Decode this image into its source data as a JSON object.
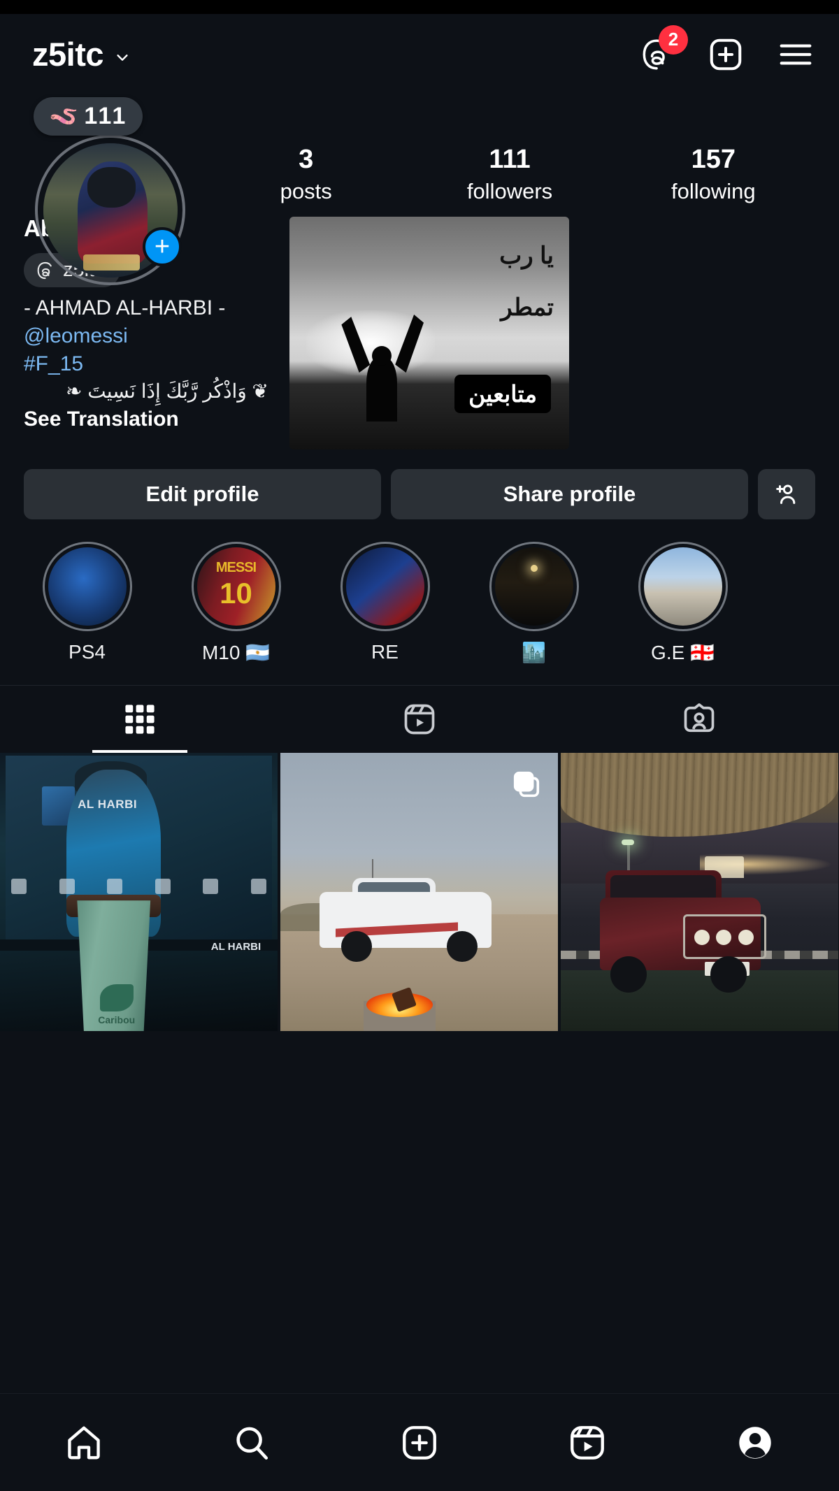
{
  "header": {
    "username": "z5itc",
    "chevron_icon": "chevron-down-icon",
    "threads_icon": "threads-icon",
    "threads_badge": "2",
    "create_icon": "plus-box-icon",
    "menu_icon": "hamburger-menu-icon"
  },
  "profile": {
    "note": {
      "emoji": "🪱",
      "text": "111"
    },
    "avatar_alt": "profile-picture",
    "add_story_label": "+",
    "stats": [
      {
        "num": "3",
        "label": "posts"
      },
      {
        "num": "111",
        "label": "followers"
      },
      {
        "num": "157",
        "label": "following"
      }
    ],
    "display_name": "Abu 7rb",
    "pronouns": "he",
    "threads_chip": {
      "icon": "threads-icon",
      "label": "z5itc"
    },
    "bio_lines": [
      {
        "text": "- AHMAD AL-HARBI -",
        "style": "plain"
      },
      {
        "text": "@leomessi",
        "style": "link"
      },
      {
        "text": "#F_15",
        "style": "link"
      }
    ],
    "bio_arabic": "❦ وَاذْكُر رَّبَّكَ إِذَا نَسِيتَ ❧",
    "see_translation": "See Translation",
    "card": {
      "line1": "يا رب",
      "line2": "تمطر",
      "badge": "متابعين"
    }
  },
  "actions": {
    "edit_profile": "Edit profile",
    "share_profile": "Share profile",
    "add_person_icon": "add-person-icon"
  },
  "highlights": [
    {
      "label": "PS4",
      "cover": "ps4-cover"
    },
    {
      "label": "M10 🇦🇷",
      "cover": "messi-cover",
      "cover_text": "MESSI",
      "cover_num": "10"
    },
    {
      "label": "RE",
      "cover": "resident-evil-cover"
    },
    {
      "label": "🏙️",
      "cover": "city-night-cover"
    },
    {
      "label": "G.E 🇬🇪",
      "cover": "georgia-cover"
    }
  ],
  "tabs": [
    {
      "name": "grid-tab",
      "icon": "grid-icon",
      "active": true
    },
    {
      "name": "reels-tab",
      "icon": "reels-icon",
      "active": false
    },
    {
      "name": "tagged-tab",
      "icon": "tagged-icon",
      "active": false
    }
  ],
  "posts": [
    {
      "name": "post-ps4-coffee",
      "overlay_text": "AL HARBI",
      "bar_text": "AL HARBI",
      "logo_text": "Caribou",
      "is_carousel": false
    },
    {
      "name": "post-pickup-fire",
      "is_carousel": true
    },
    {
      "name": "post-suv-night",
      "is_carousel": false
    }
  ],
  "bottom_nav": [
    {
      "name": "home",
      "icon": "home-icon",
      "active": false
    },
    {
      "name": "search",
      "icon": "search-icon",
      "active": false
    },
    {
      "name": "create",
      "icon": "plus-box-icon",
      "active": false
    },
    {
      "name": "reels",
      "icon": "reels-icon",
      "active": false
    },
    {
      "name": "profile",
      "icon": "profile-avatar-icon",
      "active": true
    }
  ],
  "colors": {
    "background": "#0d1117",
    "accent_blue": "#0095f6",
    "link_blue": "#7cb9f2",
    "badge_red": "#ff3040",
    "button_grey": "#2b3036"
  }
}
